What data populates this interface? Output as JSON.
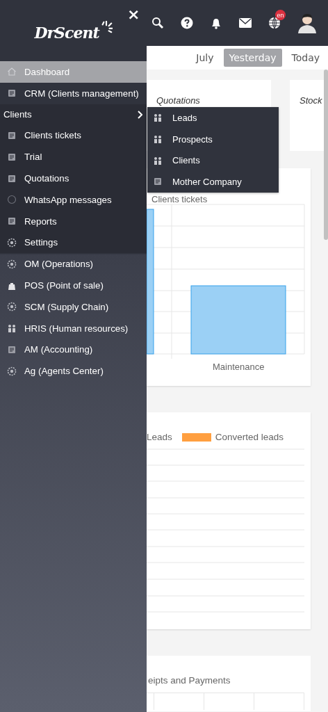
{
  "header": {
    "logo": "DrScent",
    "close": "×",
    "language_badge": "en"
  },
  "sidebar": {
    "items": [
      {
        "label": "Dashboard",
        "selected": true
      },
      {
        "label": "CRM (Clients management)",
        "selected": false
      }
    ],
    "group": {
      "label": "Clients",
      "expanded": true,
      "items": [
        {
          "label": "Clients tickets",
          "selected": false
        },
        {
          "label": "Trial",
          "selected": false
        },
        {
          "label": "Quotations",
          "selected": false
        },
        {
          "label": "WhatsApp messages",
          "selected": false
        },
        {
          "label": "Reports",
          "selected": false
        },
        {
          "label": "Settings",
          "selected": false
        }
      ],
      "flyout": [
        {
          "label": "Leads"
        },
        {
          "label": "Prospects"
        },
        {
          "label": "Clients"
        },
        {
          "label": "Mother Company"
        }
      ]
    },
    "modules": [
      {
        "label": "OM (Operations)",
        "selected": false
      },
      {
        "label": "POS (Point of sale)",
        "selected": false
      },
      {
        "label": "SCM (Supply Chain)",
        "selected": false
      },
      {
        "label": "HRIS (Human resources)",
        "selected": false
      },
      {
        "label": "AM (Accounting)",
        "selected": false
      },
      {
        "label": "Ag (Agents Center)",
        "selected": false
      }
    ]
  },
  "periods": [
    {
      "label": "July",
      "selected": false
    },
    {
      "label": "Yesterday",
      "selected": true
    },
    {
      "label": "Today",
      "selected": false
    }
  ],
  "kpi_cards": [
    {
      "title": "Quotations"
    },
    {
      "title": "Stock"
    }
  ],
  "tickets_chart": {
    "title": "Clients tickets",
    "category_label": "Maintenance"
  },
  "leads_chart": {
    "legend": [
      {
        "label": "Leads"
      },
      {
        "label": "Converted leads",
        "color": "#ff9f40"
      }
    ]
  },
  "payments_card": {
    "title": "eipts and Payments"
  }
}
